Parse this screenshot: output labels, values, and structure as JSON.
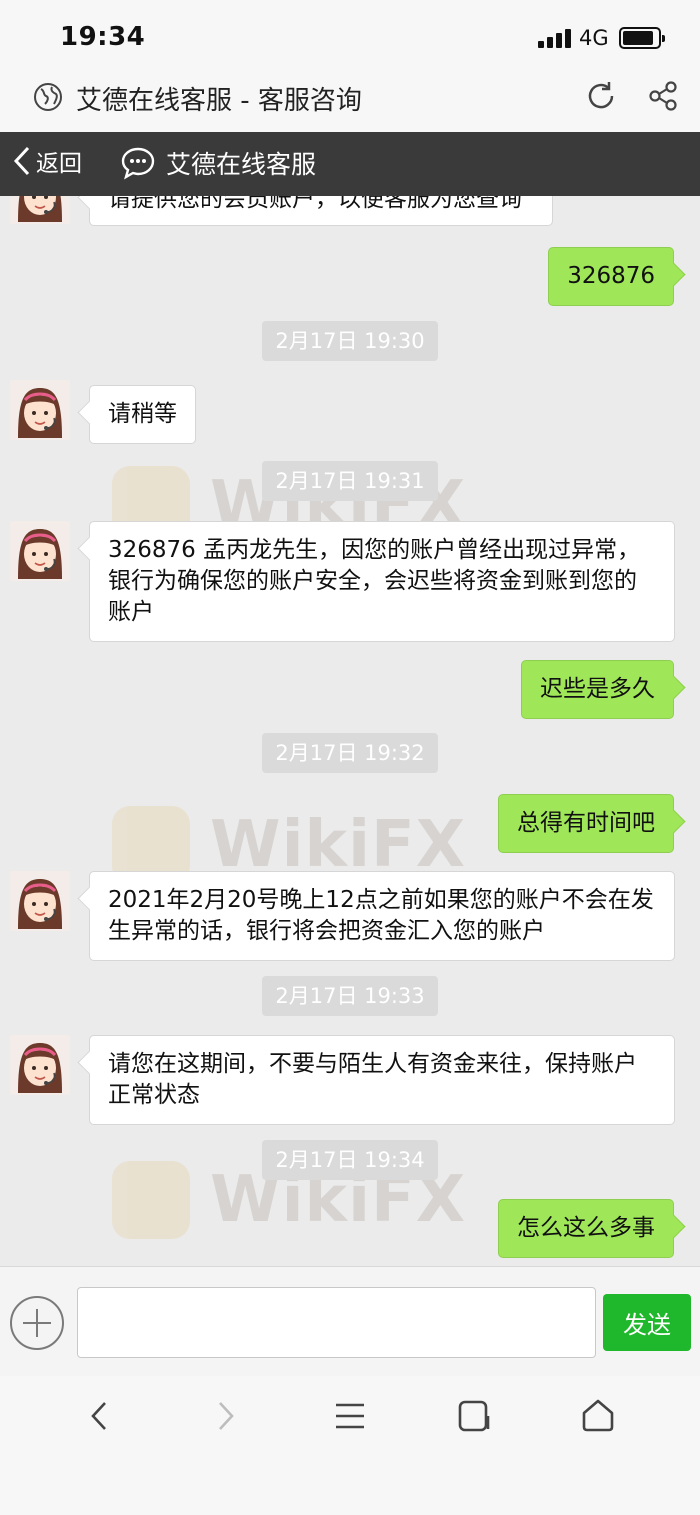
{
  "status_bar": {
    "time": "19:34",
    "network": "4G"
  },
  "browser": {
    "title": "艾德在线客服 - 客服咨询"
  },
  "chat_header": {
    "back_label": "返回",
    "service_name": "艾德在线客服"
  },
  "messages": [
    {
      "side": "left",
      "text": "请提供您的会员账户，以便客服为您查询"
    },
    {
      "side": "right",
      "text": "326876"
    },
    {
      "side": "time",
      "text": "2月17日 19:30"
    },
    {
      "side": "left",
      "text": "请稍等"
    },
    {
      "side": "time",
      "text": "2月17日 19:31"
    },
    {
      "side": "left",
      "text": "326876 孟丙龙先生，因您的账户曾经出现过异常，银行为确保您的账户安全，会迟些将资金到账到您的账户"
    },
    {
      "side": "right",
      "text": "迟些是多久"
    },
    {
      "side": "time",
      "text": "2月17日 19:32"
    },
    {
      "side": "right",
      "text": "总得有时间吧"
    },
    {
      "side": "left",
      "text": "2021年2月20号晚上12点之前如果您的账户不会在发生异常的话，银行将会把资金汇入您的账户"
    },
    {
      "side": "time",
      "text": "2月17日 19:33"
    },
    {
      "side": "left",
      "text": "请您在这期间，不要与陌生人有资金来往，保持账户正常状态"
    },
    {
      "side": "time",
      "text": "2月17日 19:34"
    },
    {
      "side": "right",
      "text": "怎么这么多事"
    }
  ],
  "input_bar": {
    "placeholder": "",
    "send_label": "发送"
  },
  "watermark": {
    "text": "WikiFX"
  },
  "colors": {
    "bubble_right": "#9fe658",
    "send_button": "#1fb82c",
    "header_bg": "#3a3a3a"
  },
  "icons": [
    "globe-icon",
    "refresh-icon",
    "share-icon",
    "back-chevron-icon",
    "chat-bubble-icon",
    "plus-icon",
    "nav-back-icon",
    "nav-forward-icon",
    "menu-icon",
    "tabs-icon",
    "home-icon"
  ]
}
